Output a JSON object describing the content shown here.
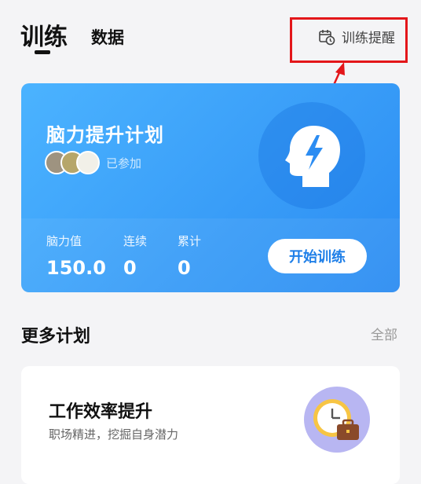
{
  "tabs": {
    "active_label": "训练",
    "secondary_label": "数据"
  },
  "reminder": {
    "label": "训练提醒",
    "icon": "calendar-clock-icon"
  },
  "annotation": {
    "color": "#e3161a"
  },
  "plan": {
    "title": "脑力提升计划",
    "joined_label": "已参加",
    "stats": [
      {
        "label": "脑力值",
        "value": "150.0"
      },
      {
        "label": "连续",
        "value": "0"
      },
      {
        "label": "累计",
        "value": "0"
      }
    ],
    "start_button": "开始训练",
    "icon": "brain-head-icon",
    "accent": "#2b8cf2"
  },
  "more": {
    "title": "更多计划",
    "all_label": "全部",
    "items": [
      {
        "title": "工作效率提升",
        "desc": "职场精进，挖掘自身潜力",
        "icon": "clock-briefcase-icon"
      }
    ]
  }
}
